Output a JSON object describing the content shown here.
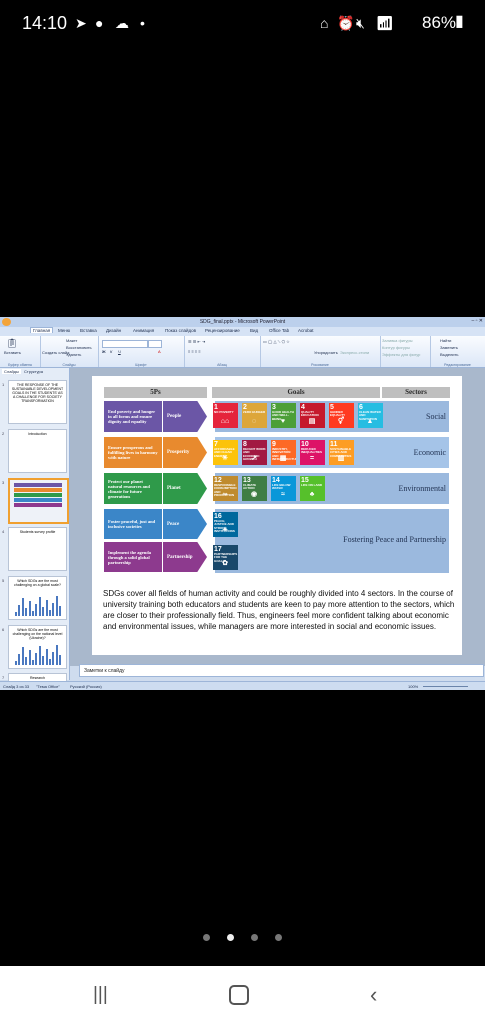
{
  "status_bar": {
    "time": "14:10",
    "battery": "86%"
  },
  "window": {
    "title": "SDG_final.pptx - Microsoft PowerPoint"
  },
  "ribbon": {
    "tabs": [
      "Главная",
      "Меню",
      "Вставка",
      "Дизайн",
      "Анимация",
      "Показ слайдов",
      "Рецензирование",
      "Вид",
      "Office Tab",
      "Acrobat"
    ],
    "groups": [
      "Буфер обмена",
      "Слайды",
      "Шрифт",
      "Абзац",
      "Рисование",
      "Редактирование"
    ],
    "buttons": {
      "paste": "Вставить",
      "new_slide": "Создать слайд",
      "layout": "Макет",
      "reset": "Восстановить",
      "delete": "Удалить",
      "arrange": "Упорядочить",
      "quick_styles": "Экспресс-стили",
      "shape_fill": "Заливка фигуры",
      "shape_outline": "Контур фигуры",
      "shape_effects": "Эффекты для фигур",
      "find": "Найти",
      "replace": "Заменить",
      "select": "Выделить"
    }
  },
  "panel_tabs": {
    "slides": "Слайды",
    "outline": "Структура"
  },
  "thumbnails": [
    {
      "num": "1",
      "title": "THE RESPONSE OF THE SUSTAINABLE DEVELOPMENT GOALS IN THE STUDENTS' AS A CHALLENGE FOR SOCIETY TRANSFORMATION"
    },
    {
      "num": "2",
      "title": "Introduction"
    },
    {
      "num": "3",
      "title": ""
    },
    {
      "num": "4",
      "title": "Students survey profile"
    },
    {
      "num": "5",
      "title": "Which SDGs are the most challenging on a global scale?"
    },
    {
      "num": "6",
      "title": "Which SDGs are the most challenging on the national level (Ukraine)?"
    },
    {
      "num": "7",
      "title": "Research"
    }
  ],
  "slide": {
    "headers": {
      "ps": "5Ps",
      "goals": "Goals",
      "sectors": "Sectors"
    },
    "rows": [
      {
        "desc": "End poverty and hunger in all forms and ensure dignity and equality",
        "p": "People",
        "sector": "Social",
        "color": "#6b56a6"
      },
      {
        "desc": "Ensure prosperous and fulfilling lives in harmony with nature",
        "p": "Prosperity",
        "sector": "Economic",
        "color": "#e88a2e"
      },
      {
        "desc": "Protect our planet natural resources and climate for future generations",
        "p": "Planet",
        "sector": "Environmental",
        "color": "#2f9a4a"
      },
      {
        "desc": "Foster peaceful, just and inclusive societies",
        "p": "Peace",
        "sector": "Fostering Peace and Partnership",
        "color": "#3b86c8"
      },
      {
        "desc": "Implement the agenda through a solid global partnership",
        "p": "Partnership",
        "color": "#8d3a8e"
      }
    ],
    "goals": [
      {
        "n": "1",
        "t": "NO POVERTY",
        "c": "#e5243b"
      },
      {
        "n": "2",
        "t": "ZERO HUNGER",
        "c": "#dda63a"
      },
      {
        "n": "3",
        "t": "GOOD HEALTH AND WELL-BEING",
        "c": "#4c9f38"
      },
      {
        "n": "4",
        "t": "QUALITY EDUCATION",
        "c": "#c5192d"
      },
      {
        "n": "5",
        "t": "GENDER EQUALITY",
        "c": "#ff3a21"
      },
      {
        "n": "6",
        "t": "CLEAN WATER AND SANITATION",
        "c": "#26bde2"
      },
      {
        "n": "7",
        "t": "AFFORDABLE AND CLEAN ENERGY",
        "c": "#fcc30b"
      },
      {
        "n": "8",
        "t": "DECENT WORK AND ECONOMIC GROWTH",
        "c": "#a21942"
      },
      {
        "n": "9",
        "t": "INDUSTRY, INNOVATION AND INFRASTRUCTURE",
        "c": "#fd6925"
      },
      {
        "n": "10",
        "t": "REDUCED INEQUALITIES",
        "c": "#dd1367"
      },
      {
        "n": "11",
        "t": "SUSTAINABLE CITIES AND COMMUNITIES",
        "c": "#fd9d24"
      },
      {
        "n": "12",
        "t": "RESPONSIBLE CONSUMPTION AND PRODUCTION",
        "c": "#bf8b2e"
      },
      {
        "n": "13",
        "t": "CLIMATE ACTION",
        "c": "#3f7e44"
      },
      {
        "n": "14",
        "t": "LIFE BELOW WATER",
        "c": "#0a97d9"
      },
      {
        "n": "15",
        "t": "LIFE ON LAND",
        "c": "#56c02b"
      },
      {
        "n": "16",
        "t": "PEACE, JUSTICE AND STRONG INSTITUTIONS",
        "c": "#00689d"
      },
      {
        "n": "17",
        "t": "PARTNERSHIPS FOR THE GOALS",
        "c": "#19486a"
      }
    ],
    "text": "SDGs cover all fields of human activity and could be roughly divided into 4 sectors. In the course of university training both educators and students are keen to pay more attention to the sectors, which are closer to their professionally field. Thus, engineers feel more confident talking about economic and environmental issues, while managers are more interested in social and economic issues."
  },
  "notes_placeholder": "Заметки к слайду",
  "status": {
    "slide": "Слайд 3 из 33",
    "theme": "\"Тема Office\"",
    "lang": "Русский (Россия)",
    "zoom": "100%"
  },
  "pager": {
    "count": 4,
    "active": 1
  }
}
